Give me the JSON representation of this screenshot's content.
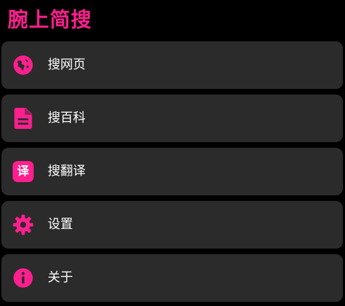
{
  "app": {
    "title": "腕上简搜"
  },
  "theme": {
    "accent": "#ff1f8e",
    "item_background": "#2b2b2b",
    "background": "#000000"
  },
  "menu": {
    "items": [
      {
        "label": "搜网页",
        "icon": "globe-icon"
      },
      {
        "label": "搜百科",
        "icon": "document-icon"
      },
      {
        "label": "搜翻译",
        "icon": "translate-icon",
        "icon_text": "译"
      },
      {
        "label": "设置",
        "icon": "gear-icon"
      },
      {
        "label": "关于",
        "icon": "info-icon"
      }
    ]
  }
}
